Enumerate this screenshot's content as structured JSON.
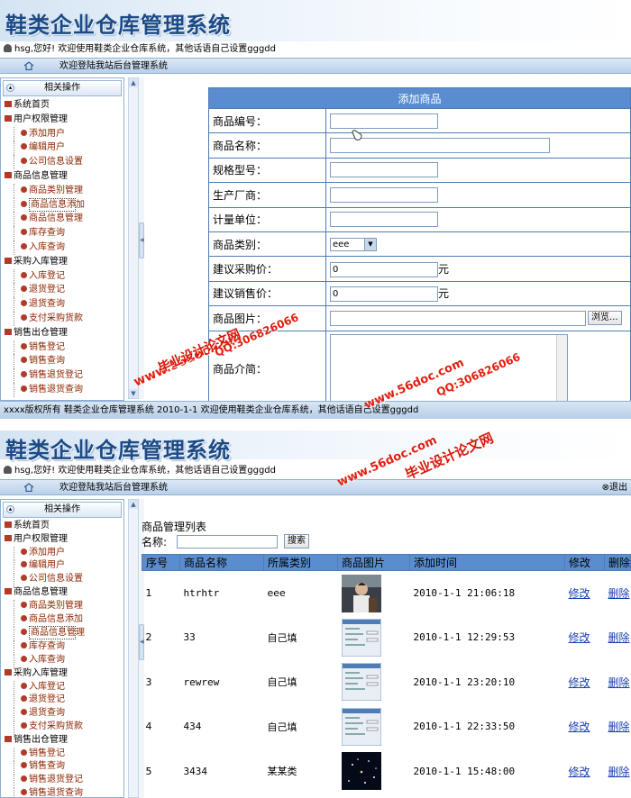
{
  "app_title": "鞋类企业仓库管理系统",
  "welcome_text": "hsg,您好! 欢迎使用鞋类企业仓库系统，其他话语自己设置gggdd",
  "nav_text": "欢迎登陆我站后台管理系统",
  "exit_label": "退出",
  "sidebar": {
    "header": "相关操作",
    "items": [
      {
        "label": "系统首页",
        "level": 1
      },
      {
        "label": "用户权限管理",
        "level": 1
      },
      {
        "label": "添加用户",
        "level": 2
      },
      {
        "label": "编辑用户",
        "level": 2
      },
      {
        "label": "公司信息设置",
        "level": 2
      },
      {
        "label": "商品信息管理",
        "level": 1
      },
      {
        "label": "商品类别管理",
        "level": 2
      },
      {
        "label": "商品信息添加",
        "level": 2
      },
      {
        "label": "商品信息管理",
        "level": 2
      },
      {
        "label": "库存查询",
        "level": 2
      },
      {
        "label": "入库查询",
        "level": 2
      },
      {
        "label": "采购入库管理",
        "level": 1
      },
      {
        "label": "入库登记",
        "level": 2
      },
      {
        "label": "退货登记",
        "level": 2
      },
      {
        "label": "退货查询",
        "level": 2
      },
      {
        "label": "支付采购货款",
        "level": 2
      },
      {
        "label": "销售出仓管理",
        "level": 1
      },
      {
        "label": "销售登记",
        "level": 2
      },
      {
        "label": "销售查询",
        "level": 2
      },
      {
        "label": "销售退货登记",
        "level": 2
      },
      {
        "label": "销售退货查询",
        "level": 2
      }
    ]
  },
  "footer_text": "xxxx版权所有  鞋类企业仓库管理系统  2010-1-1  欢迎使用鞋类企业仓库系统，其他话语自己设置gggdd",
  "form": {
    "title": "添加商品",
    "fields": [
      {
        "label": "商品编号：",
        "value": "",
        "unit": ""
      },
      {
        "label": "商品名称：",
        "value": "",
        "unit": ""
      },
      {
        "label": "规格型号：",
        "value": "",
        "unit": ""
      },
      {
        "label": "生产厂商：",
        "value": "",
        "unit": ""
      },
      {
        "label": "计量单位：",
        "value": "",
        "unit": ""
      },
      {
        "label": "商品类别：",
        "value": "eee",
        "unit": ""
      },
      {
        "label": "建议采购价：",
        "value": "0",
        "unit": "元"
      },
      {
        "label": "建议销售价：",
        "value": "0",
        "unit": "元"
      },
      {
        "label": "商品图片：",
        "value": "",
        "unit": ""
      },
      {
        "label": "商品介简：",
        "value": "",
        "unit": ""
      }
    ],
    "browse_label": "浏览..."
  },
  "list": {
    "title": "商品管理列表",
    "search_label": "名称:",
    "search_button": "搜索",
    "columns": [
      "序号",
      "商品名称",
      "所属类别",
      "商品图片",
      "添加时间",
      "修改",
      "删除"
    ],
    "rows": [
      {
        "no": "1",
        "name": "htrhtr",
        "category": "eee",
        "time": "2010-1-1  21:06:18",
        "edit": "修改",
        "del": "删除",
        "thumb": "photo"
      },
      {
        "no": "2",
        "name": "33",
        "category": "自己填",
        "time": "2010-1-1  12:29:53",
        "edit": "修改",
        "del": "删除",
        "thumb": "screen"
      },
      {
        "no": "3",
        "name": "rewrew",
        "category": "自己填",
        "time": "2010-1-1  23:20:10",
        "edit": "修改",
        "del": "删除",
        "thumb": "screen"
      },
      {
        "no": "4",
        "name": "434",
        "category": "自己填",
        "time": "2010-1-1  22:33:50",
        "edit": "修改",
        "del": "删除",
        "thumb": "screen"
      },
      {
        "no": "5",
        "name": "3434",
        "category": "某某类",
        "time": "2010-1-1  15:48:00",
        "edit": "修改",
        "del": "删除",
        "thumb": "dark"
      }
    ]
  },
  "watermarks": {
    "site": "www.56doc.com",
    "qq": "QQ:306826066",
    "name": "毕业设计论文网"
  },
  "colors": {
    "header_blue": "#5a8dd0",
    "border_blue": "#4f7cb6",
    "tree_red": "#b23a2a",
    "watermark_red": "#e02010",
    "title_blue": "#1b4a86"
  }
}
